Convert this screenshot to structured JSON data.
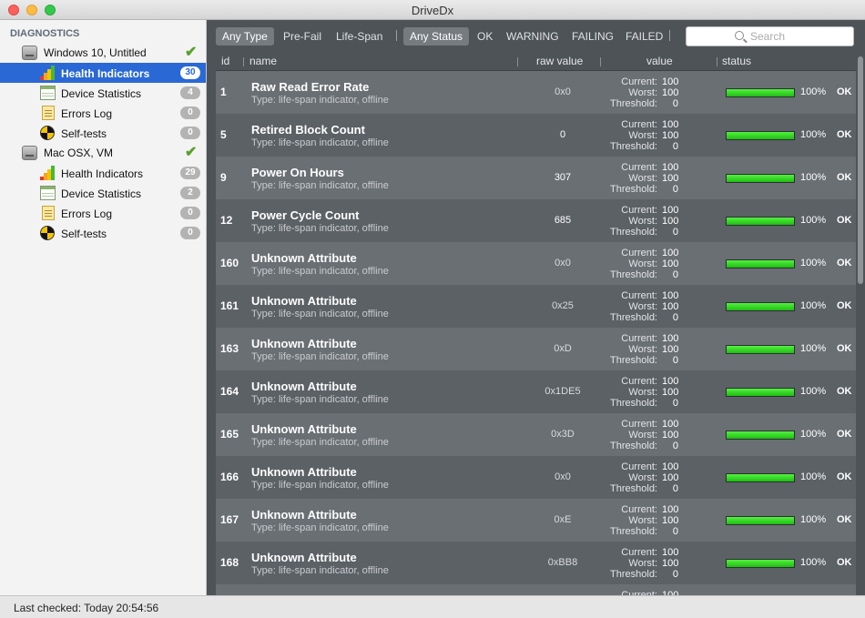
{
  "window": {
    "title": "DriveDx"
  },
  "sidebar": {
    "heading": "DIAGNOSTICS",
    "drives": [
      {
        "name": "Windows 10, Untitled",
        "items": [
          {
            "label": "Health Indicators",
            "count": "30",
            "icon": "bar-chart-icon",
            "selected": true
          },
          {
            "label": "Device Statistics",
            "count": "4",
            "icon": "table-icon"
          },
          {
            "label": "Errors Log",
            "count": "0",
            "icon": "log-icon"
          },
          {
            "label": "Self-tests",
            "count": "0",
            "icon": "self-test-icon"
          }
        ]
      },
      {
        "name": "Mac OSX, VM",
        "items": [
          {
            "label": "Health Indicators",
            "count": "29",
            "icon": "bar-chart-icon"
          },
          {
            "label": "Device Statistics",
            "count": "2",
            "icon": "table-icon"
          },
          {
            "label": "Errors Log",
            "count": "0",
            "icon": "log-icon"
          },
          {
            "label": "Self-tests",
            "count": "0",
            "icon": "self-test-icon"
          }
        ]
      }
    ]
  },
  "filters": {
    "type": [
      "Any Type",
      "Pre-Fail",
      "Life-Span"
    ],
    "status": [
      "Any Status",
      "OK",
      "WARNING",
      "FAILING",
      "FAILED"
    ],
    "search_placeholder": "Search"
  },
  "table": {
    "headers": {
      "id": "id",
      "name": "name",
      "raw": "raw value",
      "value": "value",
      "status": "status"
    },
    "value_labels": {
      "current": "Current:",
      "worst": "Worst:",
      "threshold": "Threshold:"
    },
    "rows": [
      {
        "id": "1",
        "name": "Raw Read Error Rate",
        "type": "Type: life-span indicator, offline",
        "raw": "0x0",
        "current": "100",
        "worst": "100",
        "threshold": "0",
        "health": 1.0,
        "pct": "100%",
        "status": "OK"
      },
      {
        "id": "5",
        "name": "Retired Block Count",
        "type": "Type: life-span indicator, offline",
        "raw": "0",
        "current": "100",
        "worst": "100",
        "threshold": "0",
        "health": 1.0,
        "pct": "100%",
        "status": "OK"
      },
      {
        "id": "9",
        "name": "Power On Hours",
        "type": "Type: life-span indicator, offline",
        "raw": "307",
        "current": "100",
        "worst": "100",
        "threshold": "0",
        "health": 1.0,
        "pct": "100%",
        "status": "OK"
      },
      {
        "id": "12",
        "name": "Power Cycle Count",
        "type": "Type: life-span indicator, offline",
        "raw": "685",
        "current": "100",
        "worst": "100",
        "threshold": "0",
        "health": 1.0,
        "pct": "100%",
        "status": "OK"
      },
      {
        "id": "160",
        "name": "Unknown Attribute",
        "type": "Type: life-span indicator, offline",
        "raw": "0x0",
        "current": "100",
        "worst": "100",
        "threshold": "0",
        "health": 1.0,
        "pct": "100%",
        "status": "OK"
      },
      {
        "id": "161",
        "name": "Unknown Attribute",
        "type": "Type: life-span indicator, offline",
        "raw": "0x25",
        "current": "100",
        "worst": "100",
        "threshold": "0",
        "health": 1.0,
        "pct": "100%",
        "status": "OK"
      },
      {
        "id": "163",
        "name": "Unknown Attribute",
        "type": "Type: life-span indicator, offline",
        "raw": "0xD",
        "current": "100",
        "worst": "100",
        "threshold": "0",
        "health": 1.0,
        "pct": "100%",
        "status": "OK"
      },
      {
        "id": "164",
        "name": "Unknown Attribute",
        "type": "Type: life-span indicator, offline",
        "raw": "0x1DE5",
        "current": "100",
        "worst": "100",
        "threshold": "0",
        "health": 1.0,
        "pct": "100%",
        "status": "OK"
      },
      {
        "id": "165",
        "name": "Unknown Attribute",
        "type": "Type: life-span indicator, offline",
        "raw": "0x3D",
        "current": "100",
        "worst": "100",
        "threshold": "0",
        "health": 1.0,
        "pct": "100%",
        "status": "OK"
      },
      {
        "id": "166",
        "name": "Unknown Attribute",
        "type": "Type: life-span indicator, offline",
        "raw": "0x0",
        "current": "100",
        "worst": "100",
        "threshold": "0",
        "health": 1.0,
        "pct": "100%",
        "status": "OK"
      },
      {
        "id": "167",
        "name": "Unknown Attribute",
        "type": "Type: life-span indicator, offline",
        "raw": "0xE",
        "current": "100",
        "worst": "100",
        "threshold": "0",
        "health": 1.0,
        "pct": "100%",
        "status": "OK"
      },
      {
        "id": "168",
        "name": "Unknown Attribute",
        "type": "Type: life-span indicator, offline",
        "raw": "0xBB8",
        "current": "100",
        "worst": "100",
        "threshold": "0",
        "health": 1.0,
        "pct": "100%",
        "status": "OK"
      },
      {
        "id": "",
        "name": "",
        "type": "",
        "raw": "",
        "current": "100",
        "worst": "",
        "threshold": "",
        "health": 0,
        "pct": "",
        "status": ""
      }
    ]
  },
  "statusbar": {
    "last_checked": "Last checked: Today 20:54:56"
  },
  "colors": {
    "accent": "#2a68d6",
    "health_bar": "#2fd41f",
    "check": "#5aa02c"
  }
}
